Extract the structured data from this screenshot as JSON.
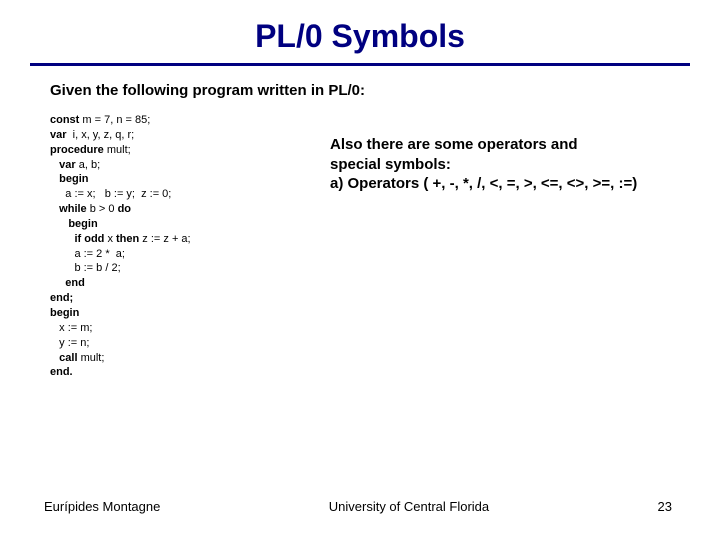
{
  "title": "PL/0 Symbols",
  "intro": "Given the following program written in PL/0:",
  "code": {
    "l1a": "const",
    "l1b": " m = 7, n = 85;",
    "l2a": "var",
    "l2b": "  i, x, y, z, q, r;",
    "l3a": "procedure",
    "l3b": " mult;",
    "l4a": "   var",
    "l4b": " a, b;",
    "l5a": "   begin",
    "l6": "     a := x;   b := y;  z := 0;",
    "l7a": "   while",
    "l7b": " b > 0 ",
    "l7c": "do",
    "l8a": "      begin",
    "l9a": "        if odd",
    "l9b": " x ",
    "l9c": "then",
    "l9d": " z := z + a;",
    "l10": "        a := 2 *  a;",
    "l11": "        b := b / 2;",
    "l12a": "     end",
    "l13a": "end;",
    "l14a": "begin",
    "l15": "   x := m;",
    "l16": "   y := n;",
    "l17a": "   call",
    "l17b": " mult;",
    "l18a": "end."
  },
  "info": {
    "line1": "Also there are some operators and",
    "line2": "special symbols:",
    "line3": "a)    Operators ( +, -, *, /,  <, =, >, <=, <>, >=, :=)"
  },
  "footer": {
    "author": "Eurípides Montagne",
    "org": "University of Central Florida",
    "page": "23"
  }
}
